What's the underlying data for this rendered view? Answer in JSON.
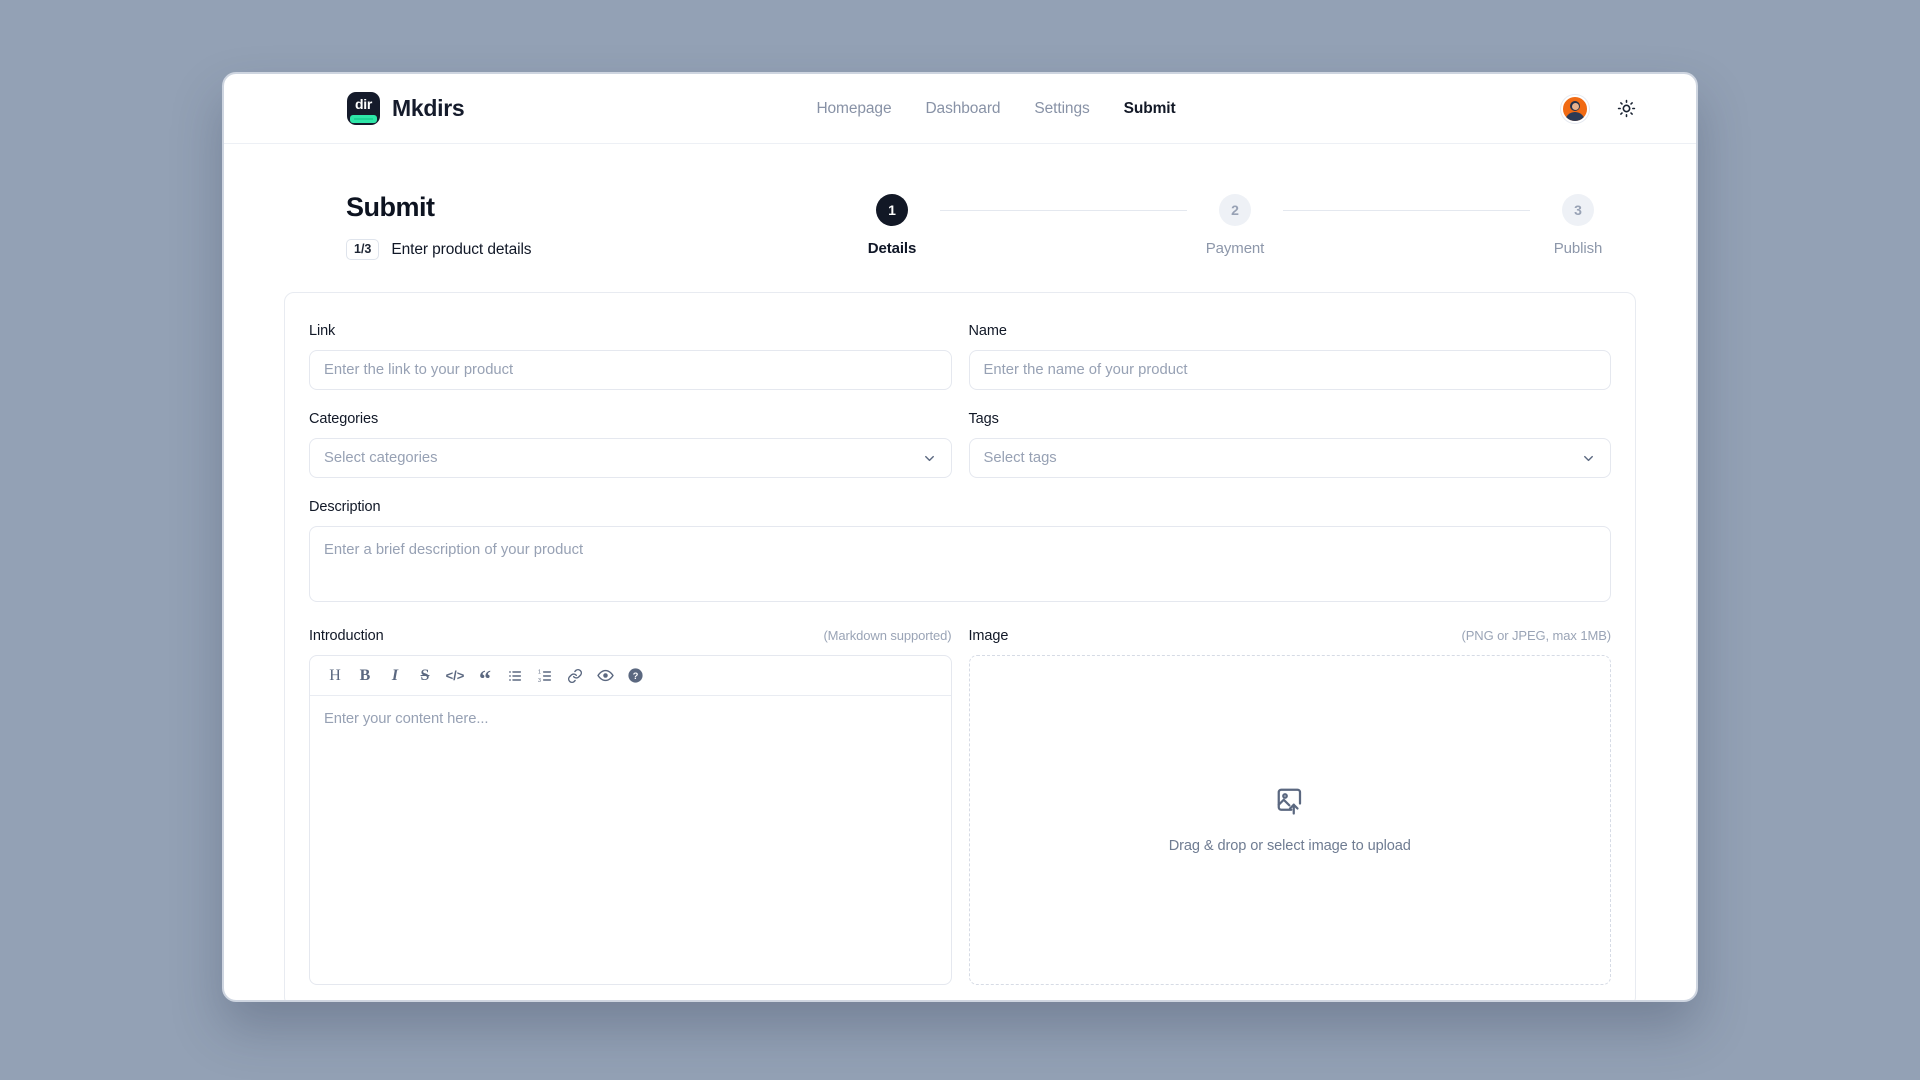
{
  "brand": {
    "logo_text": "dir",
    "name": "Mkdirs"
  },
  "nav": {
    "items": [
      {
        "label": "Homepage",
        "active": false
      },
      {
        "label": "Dashboard",
        "active": false
      },
      {
        "label": "Settings",
        "active": false
      },
      {
        "label": "Submit",
        "active": true
      }
    ]
  },
  "top_right": {
    "avatar_name": "user-avatar",
    "theme_toggle_icon": "sun-icon"
  },
  "page": {
    "title": "Submit",
    "step_badge": "1/3",
    "step_description": "Enter product details"
  },
  "stepper": {
    "steps": [
      {
        "number": "1",
        "label": "Details",
        "active": true
      },
      {
        "number": "2",
        "label": "Payment",
        "active": false
      },
      {
        "number": "3",
        "label": "Publish",
        "active": false
      }
    ]
  },
  "form": {
    "link": {
      "label": "Link",
      "placeholder": "Enter the link to your product",
      "value": ""
    },
    "name": {
      "label": "Name",
      "placeholder": "Enter the name of your product",
      "value": ""
    },
    "categories": {
      "label": "Categories",
      "placeholder": "Select categories",
      "value": ""
    },
    "tags": {
      "label": "Tags",
      "placeholder": "Select tags",
      "value": ""
    },
    "description": {
      "label": "Description",
      "placeholder": "Enter a brief description of your product",
      "value": ""
    },
    "introduction": {
      "label": "Introduction",
      "hint": "(Markdown supported)",
      "placeholder": "Enter your content here...",
      "value": "",
      "toolbar": [
        {
          "name": "heading-icon",
          "glyph": "H"
        },
        {
          "name": "bold-icon",
          "glyph": "B"
        },
        {
          "name": "italic-icon",
          "glyph": "I"
        },
        {
          "name": "strikethrough-icon",
          "glyph": "S"
        },
        {
          "name": "code-icon",
          "glyph": "</>"
        },
        {
          "name": "quote-icon",
          "glyph": "“"
        },
        {
          "name": "bullet-list-icon",
          "glyph": ""
        },
        {
          "name": "numbered-list-icon",
          "glyph": ""
        },
        {
          "name": "link-icon",
          "glyph": ""
        },
        {
          "name": "preview-eye-icon",
          "glyph": ""
        },
        {
          "name": "help-icon",
          "glyph": ""
        }
      ]
    },
    "image": {
      "label": "Image",
      "hint": "(PNG or JPEG, max 1MB)",
      "dropzone_text": "Drag & drop or select image to upload",
      "dropzone_icon": "image-upload-icon"
    }
  },
  "colors": {
    "page_background": "#93a1b5",
    "window_background": "#ffffff",
    "accent_dark": "#121826",
    "logo_accent": "#2ee6a8",
    "avatar_background": "#f06a14",
    "border": "#e5e8ef",
    "placeholder_text": "#97a1b4"
  }
}
